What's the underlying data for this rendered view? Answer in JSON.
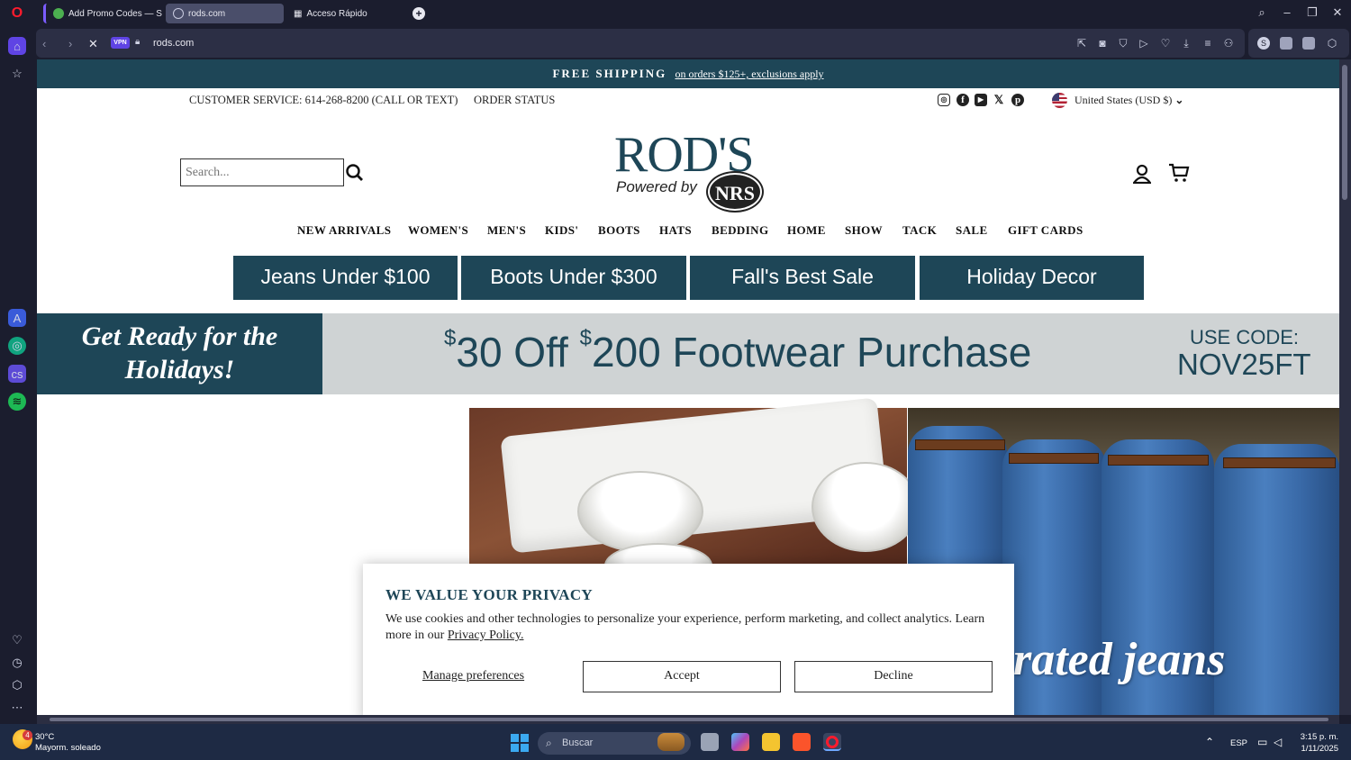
{
  "browser": {
    "tabs": [
      {
        "title": "Add Promo Codes — Simp"
      },
      {
        "title": "rods.com"
      },
      {
        "title": "Acceso Rápido"
      }
    ],
    "url": "rods.com",
    "vpn_label": "VPN"
  },
  "site": {
    "announcement": {
      "bold": "FREE SHIPPING",
      "link": "on orders $125+, exclusions apply"
    },
    "utility": {
      "customer_service": "CUSTOMER SERVICE: 614-268-8200 (CALL OR TEXT)",
      "order_status": "ORDER STATUS",
      "currency": "United States (USD $)"
    },
    "search_placeholder": "Search...",
    "logo": {
      "brand": "ROD'S",
      "powered_by": "Powered by",
      "nrs": "NRS"
    },
    "nav": [
      "NEW ARRIVALS",
      "WOMEN'S",
      "MEN'S",
      "KIDS'",
      "BOOTS",
      "HATS",
      "BEDDING",
      "HOME",
      "SHOW",
      "TACK",
      "SALE",
      "GIFT CARDS"
    ],
    "promo_buttons": [
      "Jeans Under $100",
      "Boots Under $300",
      "Fall's Best Sale",
      "Holiday Decor"
    ],
    "banner": {
      "left_line1": "Get Ready for the",
      "left_line2": "Holidays!",
      "dollar_sign": "$",
      "amount1": "30 Off ",
      "amount2": "200 Footwear Purchase",
      "code_label": "USE CODE:",
      "code": "NOV25FT"
    },
    "hero_text": "p rated jeans"
  },
  "cookie": {
    "title": "WE VALUE YOUR PRIVACY",
    "body": "We use cookies and other technologies to personalize your experience, perform marketing, and collect analytics. Learn more in our ",
    "policy_link": "Privacy Policy.",
    "manage": "Manage preferences",
    "accept": "Accept",
    "decline": "Decline"
  },
  "taskbar": {
    "temp": "30°C",
    "weather": "Mayorm. soleado",
    "search": "Buscar",
    "lang": "ESP",
    "time": "3:15 p. m.",
    "date": "1/11/2025",
    "weather_badge": "4"
  },
  "colors": {
    "brand": "#1e4657",
    "browser_bg": "#1b1d2e",
    "accent": "#5f44e4"
  }
}
